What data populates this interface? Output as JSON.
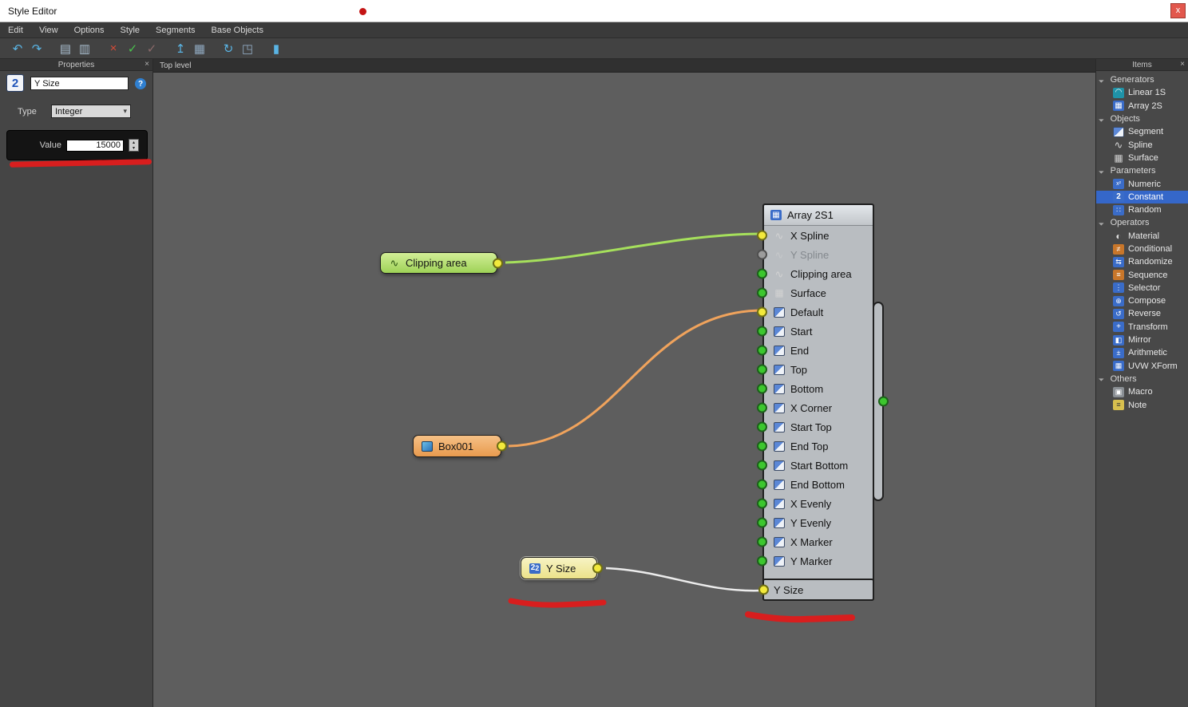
{
  "window": {
    "title": "Style Editor",
    "close_glyph": "x"
  },
  "ui": {
    "close_glyph": "×",
    "chevron_down": "▾",
    "spin_up": "▴",
    "spin_down": "▾"
  },
  "menu": {
    "items": [
      "Edit",
      "View",
      "Options",
      "Style",
      "Segments",
      "Base Objects"
    ]
  },
  "toolbar": {
    "buttons": [
      {
        "icon": "undo-icon",
        "glyph": "↶",
        "color": "#5ab4e4"
      },
      {
        "icon": "redo-icon",
        "glyph": "↷",
        "color": "#5ab4e4"
      },
      {
        "icon": "copy-icon",
        "glyph": "▤",
        "color": "#a8bccd",
        "sep": "sep"
      },
      {
        "icon": "paste-icon",
        "glyph": "▥",
        "color": "#a8bccd"
      },
      {
        "icon": "delete-icon",
        "glyph": "×",
        "color": "#d84b38",
        "sep": "sep"
      },
      {
        "icon": "validate-icon",
        "glyph": "✓",
        "color": "#49c24d"
      },
      {
        "icon": "validate-disabled-icon",
        "glyph": "✓",
        "color": "#8a6a6a"
      },
      {
        "icon": "arrange-top-icon",
        "glyph": "↥",
        "color": "#5ab4e4",
        "sep": "sep"
      },
      {
        "icon": "arrange-grid-icon",
        "glyph": "▦",
        "color": "#8fa8bf"
      },
      {
        "icon": "refresh-icon",
        "glyph": "↻",
        "color": "#5ab4e4",
        "sep": "sep"
      },
      {
        "icon": "export-icon",
        "glyph": "◳",
        "color": "#8fa8bf"
      },
      {
        "icon": "log-icon",
        "glyph": "▮",
        "color": "#5ab4e4",
        "sep": "sep"
      }
    ]
  },
  "properties": {
    "title": "Properties",
    "node_type_badge": "2",
    "name_value": "Y Size",
    "help_glyph": "?",
    "type_label": "Type",
    "type_value": "Integer",
    "value_label": "Value",
    "value": "15000"
  },
  "canvas": {
    "tab_label": "Top level",
    "nodes": {
      "clipping": {
        "label": "Clipping area"
      },
      "box": {
        "label": "Box001"
      },
      "ysize": {
        "label": "Y Size",
        "badge": "2"
      }
    },
    "array_node": {
      "title": "Array 2S1",
      "inputs": [
        {
          "label": "X Spline",
          "port": "yellow",
          "icon": "spline-icon"
        },
        {
          "label": "Y Spline",
          "port": "gray",
          "icon": "spline-icon",
          "state": "disabled"
        },
        {
          "label": "Clipping area",
          "port": "green",
          "icon": "spline-icon"
        },
        {
          "label": "Surface",
          "port": "green",
          "icon": "surface-icon"
        },
        {
          "label": "Default",
          "port": "yellow",
          "icon": "segment-icon"
        },
        {
          "label": "Start",
          "port": "green",
          "icon": "segment-icon"
        },
        {
          "label": "End",
          "port": "green",
          "icon": "segment-icon"
        },
        {
          "label": "Top",
          "port": "green",
          "icon": "segment-icon"
        },
        {
          "label": "Bottom",
          "port": "green",
          "icon": "segment-icon"
        },
        {
          "label": "X Corner",
          "port": "green",
          "icon": "segment-icon"
        },
        {
          "label": "Start Top",
          "port": "green",
          "icon": "segment-icon"
        },
        {
          "label": "End Top",
          "port": "green",
          "icon": "segment-icon"
        },
        {
          "label": "Start Bottom",
          "port": "green",
          "icon": "segment-icon"
        },
        {
          "label": "End Bottom",
          "port": "green",
          "icon": "segment-icon"
        },
        {
          "label": "X Evenly",
          "port": "green",
          "icon": "segment-icon"
        },
        {
          "label": "Y Evenly",
          "port": "green",
          "icon": "segment-icon"
        },
        {
          "label": "X Marker",
          "port": "green",
          "icon": "segment-icon"
        },
        {
          "label": "Y Marker",
          "port": "green",
          "icon": "segment-icon"
        }
      ],
      "extra_input": {
        "label": "Y Size",
        "port": "yellow"
      }
    }
  },
  "items_panel": {
    "title": "Items",
    "entries": [
      {
        "type": "group",
        "label": "Generators"
      },
      {
        "type": "item",
        "label": "Linear 1S",
        "icon": "linear-1s-icon"
      },
      {
        "type": "item",
        "label": "Array 2S",
        "icon": "array-2s-icon"
      },
      {
        "type": "group",
        "label": "Objects"
      },
      {
        "type": "item",
        "label": "Segment",
        "icon": "segment-icon"
      },
      {
        "type": "item",
        "label": "Spline",
        "icon": "spline-icon"
      },
      {
        "type": "item",
        "label": "Surface",
        "icon": "surface-icon"
      },
      {
        "type": "group",
        "label": "Parameters"
      },
      {
        "type": "item",
        "label": "Numeric",
        "icon": "numeric-icon"
      },
      {
        "type": "item",
        "label": "Constant",
        "icon": "constant-icon",
        "state": "selected"
      },
      {
        "type": "item",
        "label": "Random",
        "icon": "random-icon"
      },
      {
        "type": "group",
        "label": "Operators"
      },
      {
        "type": "item",
        "label": "Material",
        "icon": "material-icon"
      },
      {
        "type": "item",
        "label": "Conditional",
        "icon": "conditional-icon"
      },
      {
        "type": "item",
        "label": "Randomize",
        "icon": "randomize-icon"
      },
      {
        "type": "item",
        "label": "Sequence",
        "icon": "sequence-icon"
      },
      {
        "type": "item",
        "label": "Selector",
        "icon": "selector-icon"
      },
      {
        "type": "item",
        "label": "Compose",
        "icon": "compose-icon"
      },
      {
        "type": "item",
        "label": "Reverse",
        "icon": "reverse-icon"
      },
      {
        "type": "item",
        "label": "Transform",
        "icon": "transform-icon"
      },
      {
        "type": "item",
        "label": "Mirror",
        "icon": "mirror-icon"
      },
      {
        "type": "item",
        "label": "Arithmetic",
        "icon": "arithmetic-icon"
      },
      {
        "type": "item",
        "label": "UVW XForm",
        "icon": "uvw-xform-icon"
      },
      {
        "type": "group",
        "label": "Others"
      },
      {
        "type": "item",
        "label": "Macro",
        "icon": "macro-icon"
      },
      {
        "type": "item",
        "label": "Note",
        "icon": "note-icon"
      }
    ]
  },
  "colors": {
    "selection": "#3567c9",
    "annotation": "#d81e1e",
    "wire_green": "#a6e05c",
    "wire_orange": "#f0a35c",
    "wire_white": "#ececec"
  }
}
